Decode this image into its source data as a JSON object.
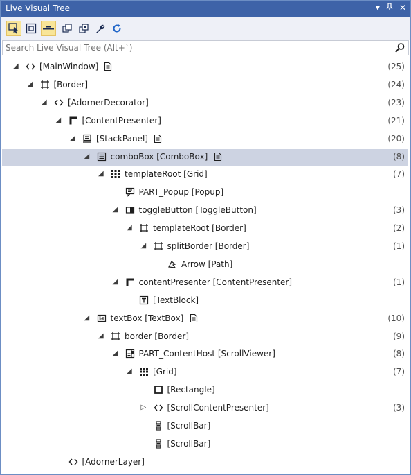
{
  "window": {
    "title": "Live Visual Tree",
    "controls": [
      "dropdown-icon",
      "pin-icon",
      "close-icon"
    ]
  },
  "toolbar": {
    "tools": [
      {
        "name": "select-element-icon",
        "active": true
      },
      {
        "name": "display-adorners-icon",
        "active": false
      },
      {
        "name": "track-focus-icon",
        "active": true
      },
      {
        "name": "show-just-my-xaml-icon",
        "active": false
      },
      {
        "name": "preview-selection-icon",
        "active": false
      },
      {
        "name": "properties-wrench-icon",
        "active": false
      },
      {
        "name": "refresh-icon",
        "active": false
      }
    ]
  },
  "search": {
    "placeholder": "Search Live Visual Tree (Alt+`)"
  },
  "tree": [
    {
      "depth": 0,
      "exp": "open",
      "icon": "angle-brackets-icon",
      "label": "[MainWindow]",
      "doc": true,
      "count": "(25)"
    },
    {
      "depth": 1,
      "exp": "open",
      "icon": "border-icon",
      "label": "[Border]",
      "doc": false,
      "count": "(24)"
    },
    {
      "depth": 2,
      "exp": "open",
      "icon": "angle-brackets-icon",
      "label": "[AdornerDecorator]",
      "doc": false,
      "count": "(23)"
    },
    {
      "depth": 3,
      "exp": "open",
      "icon": "content-presenter-icon",
      "label": "[ContentPresenter]",
      "doc": false,
      "count": "(21)"
    },
    {
      "depth": 4,
      "exp": "open",
      "icon": "stackpanel-icon",
      "label": "[StackPanel]",
      "doc": true,
      "count": "(20)"
    },
    {
      "depth": 5,
      "exp": "open",
      "icon": "combobox-icon",
      "label": "comboBox [ComboBox]",
      "doc": true,
      "count": "(8)",
      "selected": true
    },
    {
      "depth": 6,
      "exp": "open",
      "icon": "grid-icon",
      "label": "templateRoot [Grid]",
      "doc": false,
      "count": "(7)"
    },
    {
      "depth": 7,
      "exp": "none",
      "icon": "popup-icon",
      "label": "PART_Popup [Popup]",
      "doc": false,
      "count": ""
    },
    {
      "depth": 7,
      "exp": "open",
      "icon": "toggle-button-icon",
      "label": "toggleButton [ToggleButton]",
      "doc": false,
      "count": "(3)"
    },
    {
      "depth": 8,
      "exp": "open",
      "icon": "border-icon",
      "label": "templateRoot [Border]",
      "doc": false,
      "count": "(2)"
    },
    {
      "depth": 9,
      "exp": "open",
      "icon": "border-icon",
      "label": "splitBorder [Border]",
      "doc": false,
      "count": "(1)"
    },
    {
      "depth": 10,
      "exp": "none",
      "icon": "path-icon",
      "label": "Arrow [Path]",
      "doc": false,
      "count": ""
    },
    {
      "depth": 7,
      "exp": "open",
      "icon": "content-presenter-icon",
      "label": "contentPresenter [ContentPresenter]",
      "doc": false,
      "count": "(1)"
    },
    {
      "depth": 8,
      "exp": "none",
      "icon": "textblock-icon",
      "label": "[TextBlock]",
      "doc": false,
      "count": ""
    },
    {
      "depth": 5,
      "exp": "open",
      "icon": "textbox-icon",
      "label": "textBox [TextBox]",
      "doc": true,
      "count": "(10)"
    },
    {
      "depth": 6,
      "exp": "open",
      "icon": "border-icon",
      "label": "border [Border]",
      "doc": false,
      "count": "(9)"
    },
    {
      "depth": 7,
      "exp": "open",
      "icon": "scrollviewer-icon",
      "label": "PART_ContentHost [ScrollViewer]",
      "doc": false,
      "count": "(8)"
    },
    {
      "depth": 8,
      "exp": "open",
      "icon": "grid-icon",
      "label": "[Grid]",
      "doc": false,
      "count": "(7)"
    },
    {
      "depth": 9,
      "exp": "none",
      "icon": "rectangle-icon",
      "label": "[Rectangle]",
      "doc": false,
      "count": ""
    },
    {
      "depth": 9,
      "exp": "closed",
      "icon": "angle-brackets-icon",
      "label": "[ScrollContentPresenter]",
      "doc": false,
      "count": "(3)"
    },
    {
      "depth": 9,
      "exp": "none",
      "icon": "scrollbar-icon",
      "label": "[ScrollBar]",
      "doc": false,
      "count": ""
    },
    {
      "depth": 9,
      "exp": "none",
      "icon": "scrollbar-icon",
      "label": "[ScrollBar]",
      "doc": false,
      "count": ""
    },
    {
      "depth": 3,
      "exp": "none",
      "icon": "angle-brackets-icon",
      "label": "[AdornerLayer]",
      "doc": false,
      "count": ""
    }
  ]
}
